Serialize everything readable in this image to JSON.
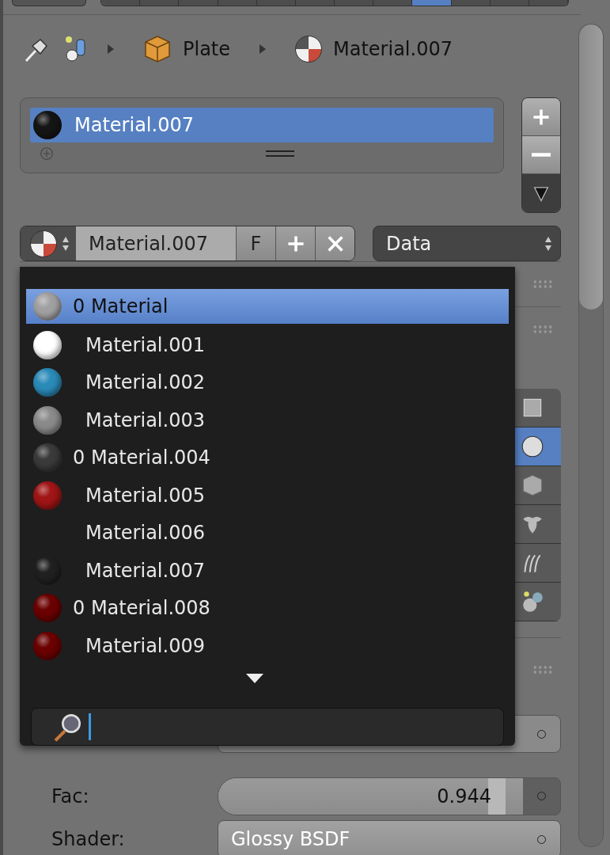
{
  "editor_tabs": [
    {
      "selected": false
    },
    {
      "selected": false
    },
    {
      "selected": false
    },
    {
      "selected": false
    },
    {
      "selected": false
    },
    {
      "selected": false
    },
    {
      "selected": false
    },
    {
      "selected": false
    },
    {
      "selected": true
    },
    {
      "selected": false
    },
    {
      "selected": false
    },
    {
      "selected": false
    }
  ],
  "breadcrumb": [
    {
      "kind": "object",
      "label": "Plate"
    },
    {
      "kind": "material",
      "label": "Material.007"
    }
  ],
  "material_slots": [
    {
      "name": "Material.007",
      "selected": true,
      "color": "#151515"
    }
  ],
  "datablock": {
    "name": "Material.007",
    "fake_user": "F",
    "link": "Data"
  },
  "popup": {
    "items": [
      {
        "users": "0",
        "name": "Material",
        "selected": true,
        "color": "#a0a0a0"
      },
      {
        "name": "Material.001",
        "selected": false,
        "color": "#ffffff"
      },
      {
        "name": "Material.002",
        "selected": false,
        "color": "#2a8ab8"
      },
      {
        "name": "Material.003",
        "selected": false,
        "color": "#8a8a8a"
      },
      {
        "users": "0",
        "name": "Material.004",
        "selected": false,
        "color": "#3a3a3a"
      },
      {
        "name": "Material.005",
        "selected": false,
        "color": "#a01515"
      },
      {
        "name": "Material.006",
        "selected": false
      },
      {
        "name": "Material.007",
        "selected": false,
        "color": "#202020"
      },
      {
        "users": "0",
        "name": "Material.008",
        "selected": false,
        "color": "#6b0000"
      },
      {
        "name": "Material.009",
        "selected": false,
        "color": "#6b0000"
      }
    ]
  },
  "preview_types": [
    {
      "kind": "plane",
      "selected": false
    },
    {
      "kind": "sphere",
      "selected": true
    },
    {
      "kind": "cube",
      "selected": false
    },
    {
      "kind": "monkey",
      "selected": false
    },
    {
      "kind": "hair",
      "selected": false
    },
    {
      "kind": "sky",
      "selected": false
    }
  ],
  "fields": [
    {
      "kind": "slider",
      "label": "Fac:",
      "value": "0.944",
      "level": 0.944
    },
    {
      "kind": "menu",
      "label": "Shader:",
      "value": "Glossy BSDF"
    }
  ]
}
